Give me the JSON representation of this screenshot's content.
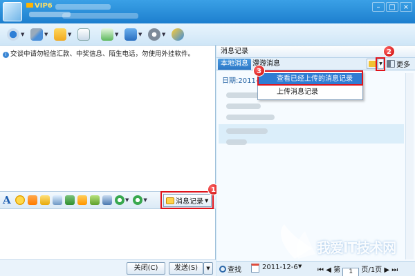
{
  "window": {
    "vip_label": "VIP6",
    "winbtn_min": "–",
    "winbtn_max": "□",
    "winbtn_close": "×"
  },
  "chat": {
    "notice": "交谈中请勿轻信汇款、中奖信息、陌生电话，勿使用外挂软件。",
    "history_button_label": "消息记录",
    "close_button": "关闭(C)",
    "send_button": "发送(S)",
    "send_arrow": "▼"
  },
  "history": {
    "panel_title": "消息记录",
    "tabs": [
      "本地消息",
      "漫游消息"
    ],
    "more_label": "更多",
    "date_line": "日期:2011-1",
    "menu": {
      "selected_item": "查看已经上传的消息记录",
      "other_item": "上传消息记录"
    },
    "bottom": {
      "find_label": "查找",
      "date_value": "2011-12-6",
      "date_dropdown": "▼",
      "page_prefix": "第",
      "page_value": "1",
      "page_suffix": "页/1页",
      "nav_first": "⏮",
      "nav_prev": "◀",
      "nav_next": "▶",
      "nav_last": "⏭"
    }
  },
  "annotations": {
    "badge_1": "1",
    "badge_2": "2",
    "badge_3": "3",
    "marker_color": "#e0141b"
  },
  "watermark": {
    "text": "我爱IT技术网"
  }
}
